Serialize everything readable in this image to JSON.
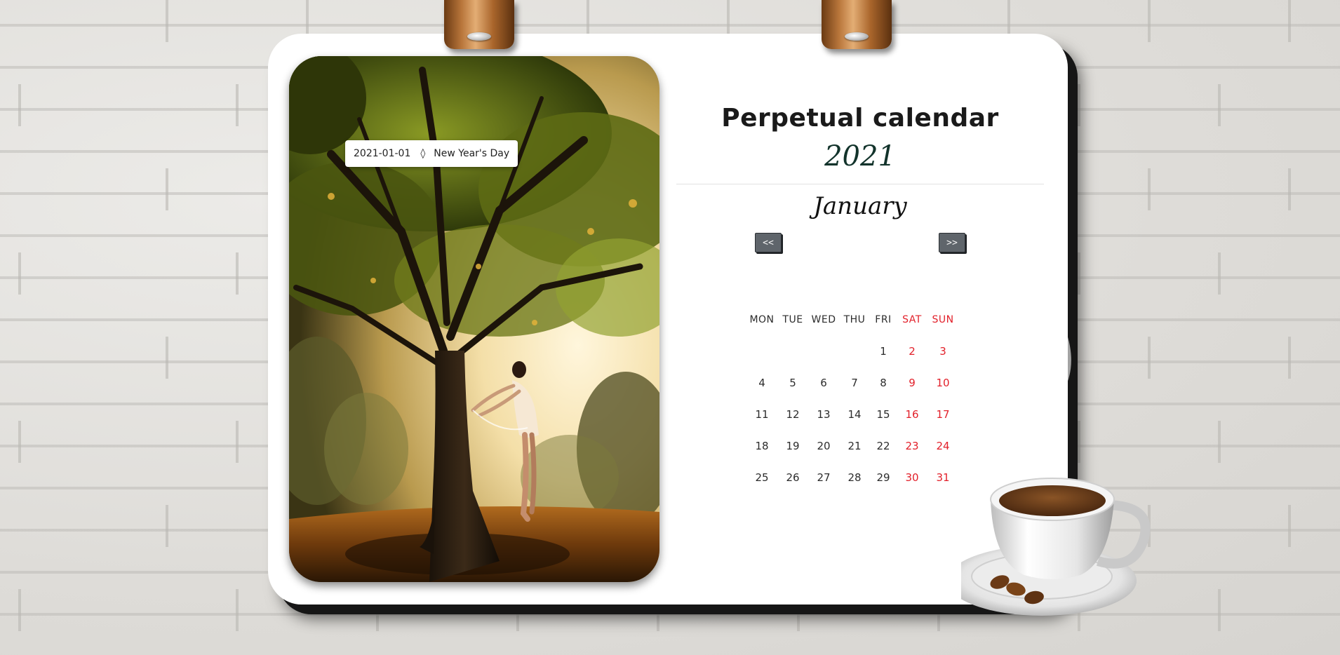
{
  "holiday": {
    "date": "2021-01-01",
    "separator": "◊",
    "name": "New Year's Day"
  },
  "calendar": {
    "title": "Perpetual calendar",
    "year": "2021",
    "month": "January",
    "prev_label": "<<",
    "next_label": ">>",
    "weekdays": [
      "MON",
      "TUE",
      "WED",
      "THU",
      "FRI",
      "SAT",
      "SUN"
    ],
    "weeks": [
      [
        "",
        "",
        "",
        "",
        "1",
        "2",
        "3"
      ],
      [
        "4",
        "5",
        "6",
        "7",
        "8",
        "9",
        "10"
      ],
      [
        "11",
        "12",
        "13",
        "14",
        "15",
        "16",
        "17"
      ],
      [
        "18",
        "19",
        "20",
        "21",
        "22",
        "23",
        "24"
      ],
      [
        "25",
        "26",
        "27",
        "28",
        "29",
        "30",
        "31"
      ]
    ]
  },
  "colors": {
    "weekend": "#e2202a",
    "nav_button": "#5f656b",
    "year": "#12332b"
  },
  "icons": {
    "photo": "tree-dancer-photo",
    "decoration": "coffee-cup-icon",
    "clips": "binder-clip-icon"
  }
}
